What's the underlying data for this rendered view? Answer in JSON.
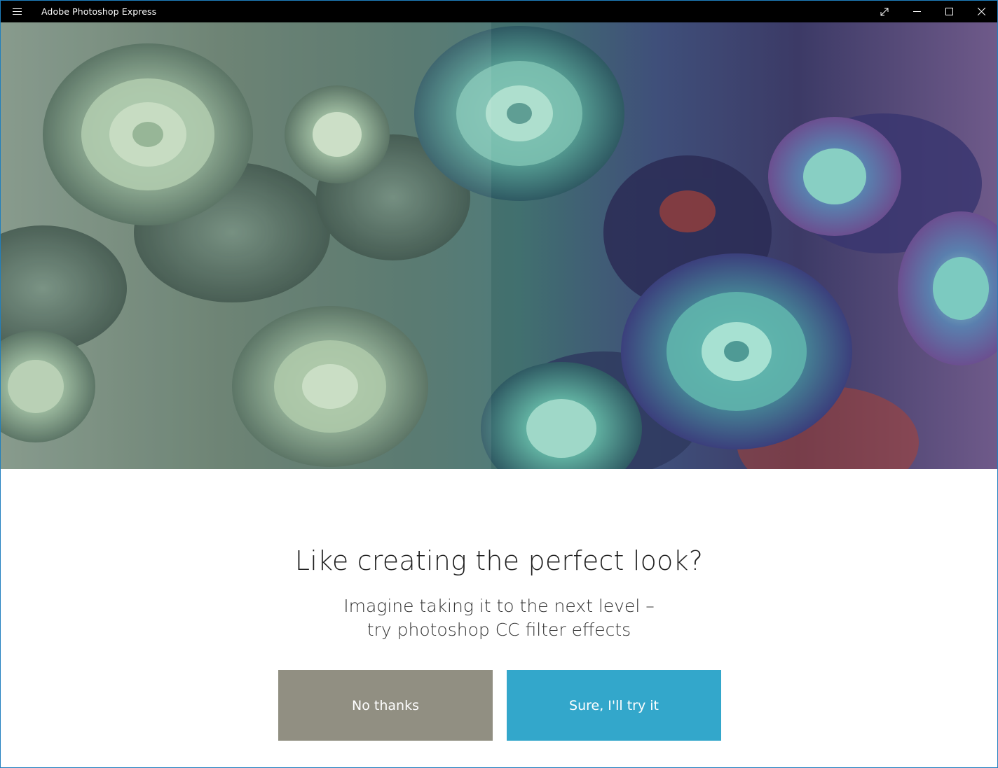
{
  "window": {
    "title": "Adobe Photoshop Express",
    "controls": [
      "expand-icon",
      "minimize-icon",
      "maximize-icon",
      "close-icon"
    ]
  },
  "hero": {
    "image": "succulent-plants-photo"
  },
  "prompt": {
    "headline": "Like creating the perfect look?",
    "subline_1": "Imagine taking it to the next level –",
    "subline_2": "try photoshop CC filter effects"
  },
  "actions": {
    "decline_label": "No thanks",
    "accept_label": "Sure, I'll try it"
  },
  "colors": {
    "titlebar": "#000000",
    "decline_button": "#918f82",
    "accept_button": "#33a7cb",
    "window_border": "#1f7fbf"
  }
}
